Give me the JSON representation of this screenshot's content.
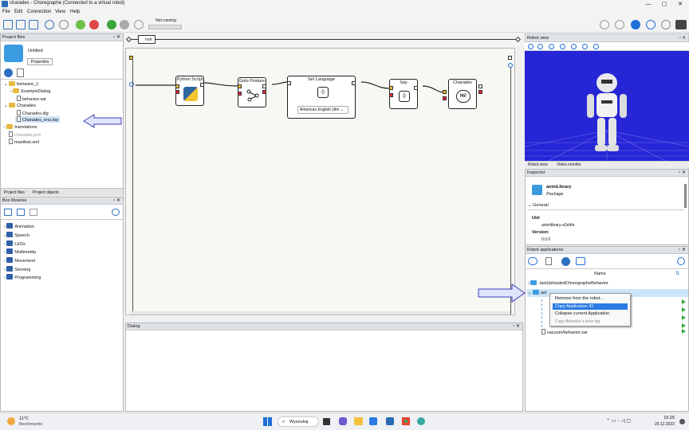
{
  "window": {
    "title": "charades - Choregraphe (Connected to a virtual robot)",
    "minimize": "—",
    "maximize": "▢",
    "close": "✕"
  },
  "menu": [
    "File",
    "Edit",
    "Connection",
    "View",
    "Help"
  ],
  "toolbar": {
    "status": "Not running"
  },
  "root_label": "root",
  "project_files": {
    "title": "Project files",
    "project_name": "Untitled",
    "properties_button": "Properties",
    "tree": [
      {
        "label": "behavior_1"
      },
      {
        "label": "ExampleDialog"
      },
      {
        "label": "behavior.xar"
      },
      {
        "label": "Charades"
      },
      {
        "label": "Charades.dlg"
      },
      {
        "label": "Charades_enu.top"
      },
      {
        "label": "translations"
      },
      {
        "label": "charades.pml"
      },
      {
        "label": "manifest.xml"
      }
    ],
    "tabs": [
      "Project files",
      "Project objects"
    ]
  },
  "box_libraries": {
    "title": "Box libraries",
    "items": [
      "Animation",
      "Speech",
      "LEDs",
      "Multimedia",
      "Movement",
      "Sensing",
      "Programming"
    ]
  },
  "flow": {
    "boxes": [
      {
        "label": "Python Script"
      },
      {
        "label": "Goto Posture"
      },
      {
        "label": "Set Language",
        "dropdown": "American English (Am"
      },
      {
        "label": "Say"
      },
      {
        "label": "Charades",
        "icon_text": "Hi!"
      }
    ]
  },
  "dialog": {
    "title": "Dialog"
  },
  "robot_view": {
    "title": "Robot view",
    "tabs": [
      "Robot view",
      "Video monitor"
    ]
  },
  "inspector": {
    "title": "Inspector",
    "name": "animLibrary",
    "type": "Package",
    "section": "General",
    "uid_label": "Uid:",
    "uid_value": "animlibrary-a2ebfa",
    "version_label": "Version:",
    "version_value": "0.0.0"
  },
  "robot_applications": {
    "title": "Robot applications",
    "column": "Name",
    "rows": [
      {
        "label": ".lastUploadedChoregrapheBehavior"
      },
      {
        "label": "ani"
      },
      {
        "label": "vacuum/behavior.xar"
      }
    ],
    "context_menu": [
      {
        "label": "Remove from the robot..."
      },
      {
        "label": "Copy Application ID"
      },
      {
        "label": "Collapse current Application"
      },
      {
        "label": "Copy Behavior's error log"
      }
    ]
  },
  "taskbar": {
    "weather_temp": "11°C",
    "weather_desc": "Bezchmurnie",
    "search": "Wyszukaj",
    "time": "15:25",
    "date": "29.12.2022"
  },
  "colors": {
    "accent": "#1f6fd8",
    "robot_bg": "#2626d6",
    "menu_highlight": "#2b7be4"
  }
}
